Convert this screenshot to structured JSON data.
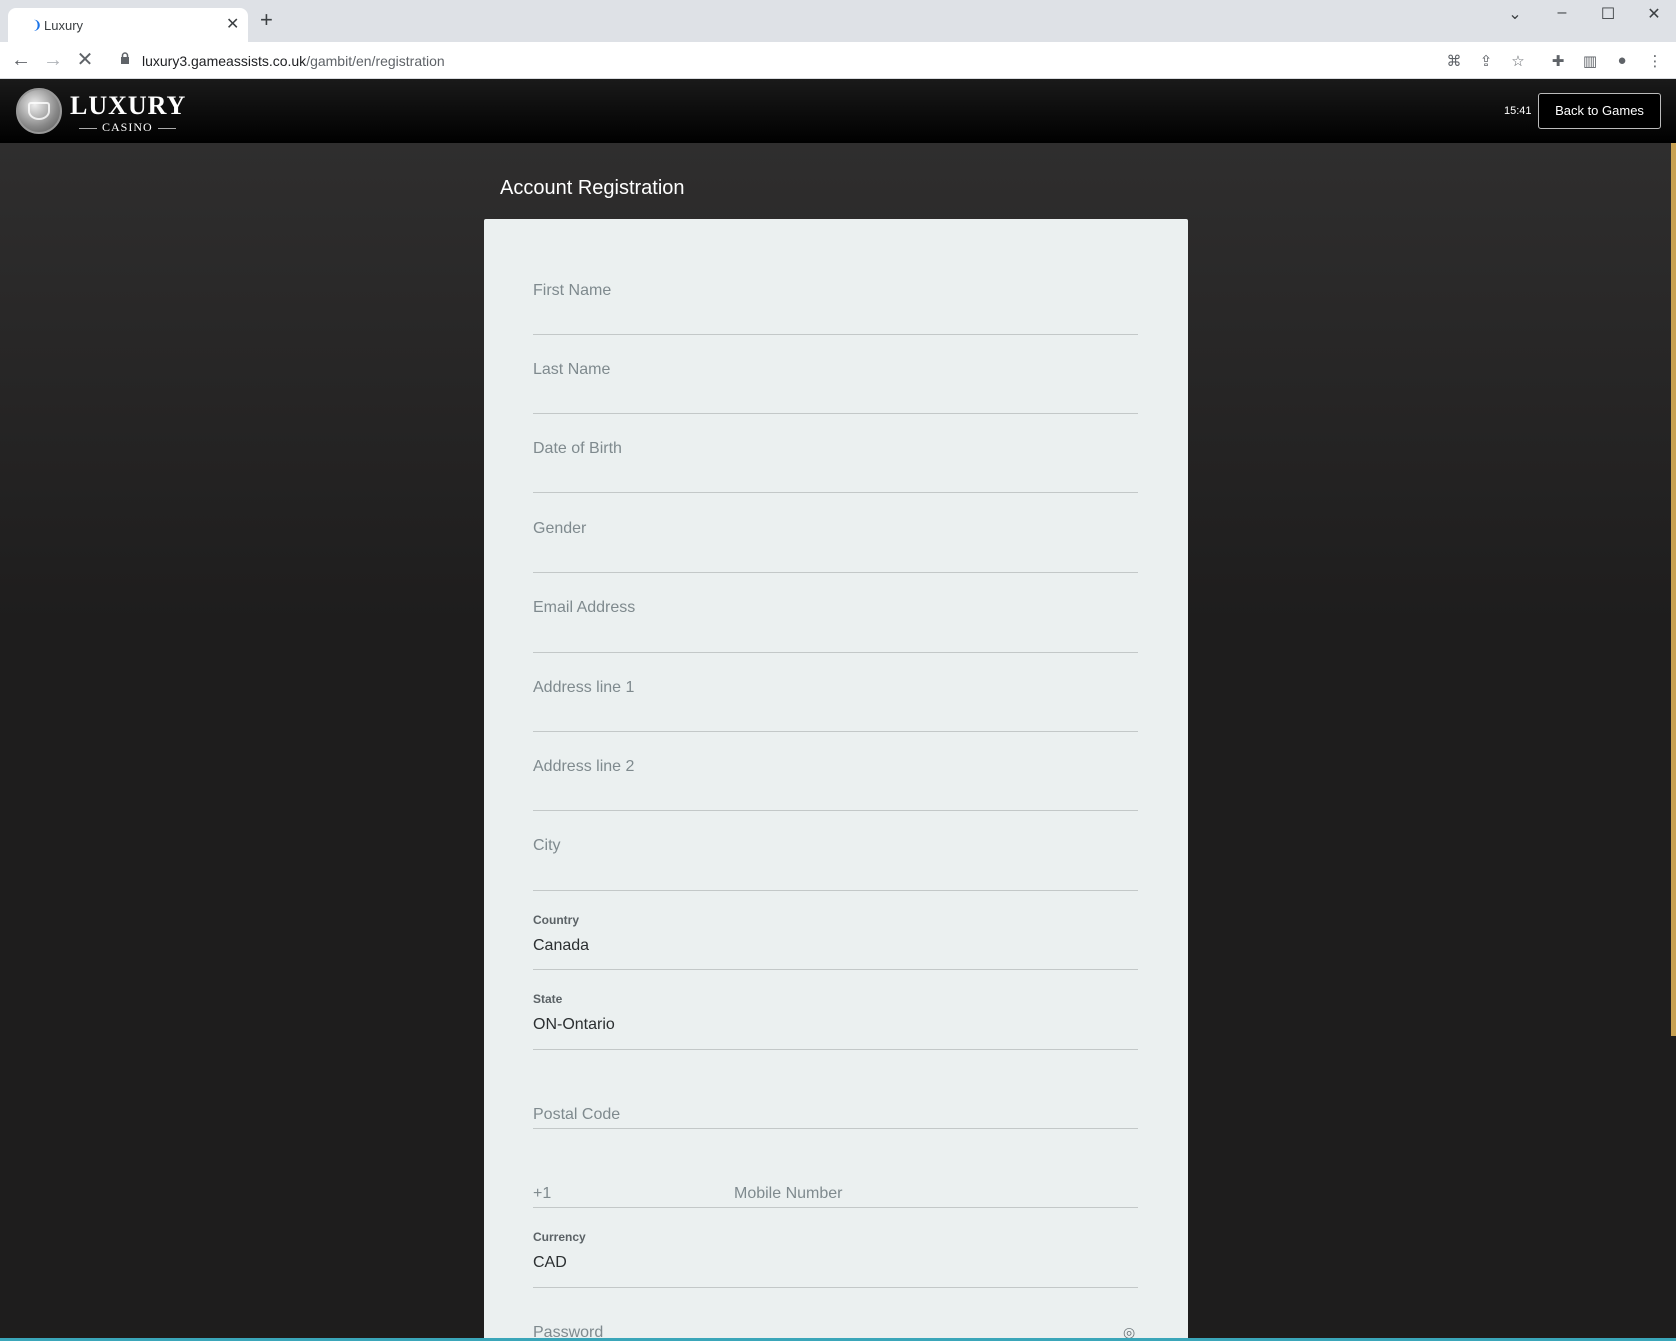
{
  "browser": {
    "tab_title": "Luxury",
    "tab_favicon": "❩",
    "new_tab": "+",
    "url_host": "luxury3.gameassists.co.uk",
    "url_path": "/gambit/en/registration"
  },
  "header": {
    "logo_title": "LUXURY",
    "logo_subtitle": "CASINO",
    "time": "15:41",
    "back_button": "Back to Games"
  },
  "page": {
    "title": "Account Registration"
  },
  "form": {
    "first_name": "First Name",
    "last_name": "Last Name",
    "dob": "Date of Birth",
    "gender": "Gender",
    "email": "Email Address",
    "address1": "Address line 1",
    "address2": "Address line 2",
    "city": "City",
    "country_label": "Country",
    "country_value": "Canada",
    "state_label": "State",
    "state_value": "ON-Ontario",
    "postal_code": "Postal Code",
    "phone_prefix": "+1",
    "mobile": "Mobile Number",
    "currency_label": "Currency",
    "currency_value": "CAD",
    "password": "Password"
  },
  "colors": {
    "accent_gold": "#c8a152",
    "card_bg": "#ebf0f0",
    "bottom_accent": "#3aa6b9"
  }
}
